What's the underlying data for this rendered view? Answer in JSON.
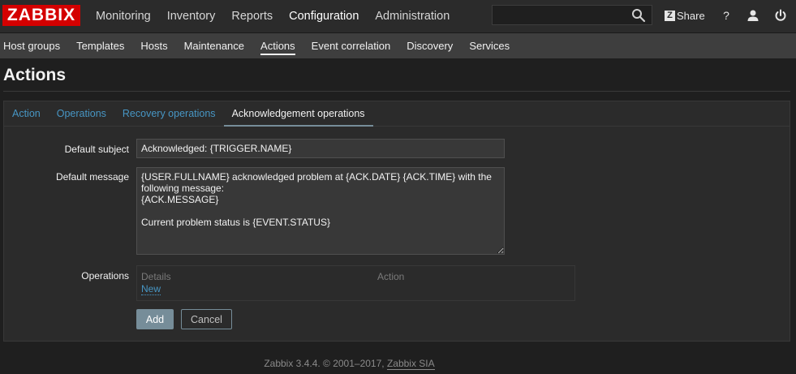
{
  "brand": {
    "logo_text": "ZABBIX",
    "color": "#d40000"
  },
  "main_menu": [
    {
      "label": "Monitoring"
    },
    {
      "label": "Inventory"
    },
    {
      "label": "Reports"
    },
    {
      "label": "Configuration"
    },
    {
      "label": "Administration"
    }
  ],
  "header": {
    "search_value": "",
    "share_badge": "Z",
    "share_label": "Share",
    "help_label": "?"
  },
  "sub_menu": [
    {
      "label": "Host groups"
    },
    {
      "label": "Templates"
    },
    {
      "label": "Hosts"
    },
    {
      "label": "Maintenance"
    },
    {
      "label": "Actions"
    },
    {
      "label": "Event correlation"
    },
    {
      "label": "Discovery"
    },
    {
      "label": "Services"
    }
  ],
  "page": {
    "title": "Actions"
  },
  "tabs": [
    {
      "label": "Action"
    },
    {
      "label": "Operations"
    },
    {
      "label": "Recovery operations"
    },
    {
      "label": "Acknowledgement operations"
    }
  ],
  "form": {
    "default_subject_label": "Default subject",
    "default_subject_value": "Acknowledged: {TRIGGER.NAME}",
    "default_message_label": "Default message",
    "default_message_value": "{USER.FULLNAME} acknowledged problem at {ACK.DATE} {ACK.TIME} with the following message:\n{ACK.MESSAGE}\n\nCurrent problem status is {EVENT.STATUS}",
    "operations_label": "Operations",
    "operations_table": {
      "col_details": "Details",
      "col_action": "Action",
      "new_link": "New"
    },
    "add_button": "Add",
    "cancel_button": "Cancel"
  },
  "footer": {
    "text": "Zabbix 3.4.4. © 2001–2017, ",
    "company_link": "Zabbix SIA"
  },
  "colors": {
    "accent_link": "#4796c4",
    "button": "#768d99",
    "background": "#1f1f1f"
  }
}
